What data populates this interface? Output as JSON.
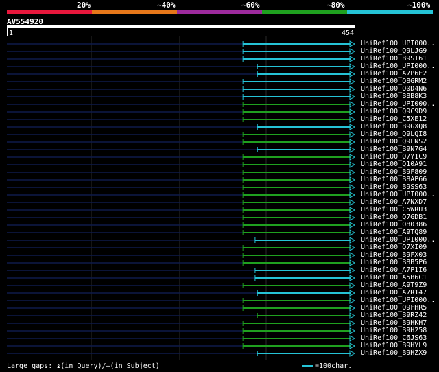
{
  "legend": {
    "labels": [
      "20%",
      "~40%",
      "~60%",
      "~80%",
      "~100%"
    ],
    "colors": [
      "#e8173c",
      "#e6771a",
      "#9c2a9c",
      "#1fa01f",
      "#25c3d6"
    ]
  },
  "query": {
    "title": "AV554920",
    "start": "1",
    "end": "454",
    "length": 454
  },
  "hits": [
    {
      "label": "UniRef100_UPI000..",
      "start": 310,
      "color": "cyan"
    },
    {
      "label": "UniRef100_Q9LJG9",
      "start": 310,
      "color": "cyan"
    },
    {
      "label": "UniRef100_B9ST61",
      "start": 310,
      "color": "cyan"
    },
    {
      "label": "UniRef100_UPI000..",
      "start": 329,
      "color": "cyan"
    },
    {
      "label": "UniRef100_A7P6E2",
      "start": 329,
      "color": "cyan"
    },
    {
      "label": "UniRef100_Q8GRM2",
      "start": 310,
      "color": "cyan"
    },
    {
      "label": "UniRef100_Q0D4N6",
      "start": 310,
      "color": "cyan"
    },
    {
      "label": "UniRef100_B8B8K3",
      "start": 310,
      "color": "cyan"
    },
    {
      "label": "UniRef100_UPI000..",
      "start": 310,
      "color": "green"
    },
    {
      "label": "UniRef100_Q9C9D9",
      "start": 310,
      "color": "green"
    },
    {
      "label": "UniRef100_C5XE12",
      "start": 310,
      "color": "green"
    },
    {
      "label": "UniRef100_B9GXQ8",
      "start": 329,
      "color": "cyan"
    },
    {
      "label": "UniRef100_Q9LQI8",
      "start": 310,
      "color": "green"
    },
    {
      "label": "UniRef100_Q9LNS2",
      "start": 310,
      "color": "green"
    },
    {
      "label": "UniRef100_B9N7G4",
      "start": 329,
      "color": "cyan"
    },
    {
      "label": "UniRef100_Q7Y1C9",
      "start": 310,
      "color": "green"
    },
    {
      "label": "UniRef100_Q10A91",
      "start": 310,
      "color": "green"
    },
    {
      "label": "UniRef100_B9F809",
      "start": 310,
      "color": "green"
    },
    {
      "label": "UniRef100_B8AP66",
      "start": 310,
      "color": "green"
    },
    {
      "label": "UniRef100_B9SS63",
      "start": 310,
      "color": "green"
    },
    {
      "label": "UniRef100_UPI000..",
      "start": 310,
      "color": "green"
    },
    {
      "label": "UniRef100_A7NXD7",
      "start": 310,
      "color": "green"
    },
    {
      "label": "UniRef100_C5WRU3",
      "start": 310,
      "color": "green"
    },
    {
      "label": "UniRef100_Q7GDB1",
      "start": 310,
      "color": "green"
    },
    {
      "label": "UniRef100_O80386",
      "start": 310,
      "color": "green"
    },
    {
      "label": "UniRef100_A9TQ89",
      "start": 310,
      "color": "green"
    },
    {
      "label": "UniRef100_UPI000..",
      "start": 326,
      "color": "cyan"
    },
    {
      "label": "UniRef100_Q7XI09",
      "start": 310,
      "color": "green"
    },
    {
      "label": "UniRef100_B9FX03",
      "start": 310,
      "color": "green"
    },
    {
      "label": "UniRef100_B8B5P6",
      "start": 310,
      "color": "green"
    },
    {
      "label": "UniRef100_A7P1I6",
      "start": 326,
      "color": "cyan"
    },
    {
      "label": "UniRef100_A5B6C1",
      "start": 326,
      "color": "cyan"
    },
    {
      "label": "UniRef100_A9T9Z9",
      "start": 310,
      "color": "green"
    },
    {
      "label": "UniRef100_A7R147",
      "start": 329,
      "color": "cyan"
    },
    {
      "label": "UniRef100_UPI000..",
      "start": 310,
      "color": "green"
    },
    {
      "label": "UniRef100_Q9FHR5",
      "start": 310,
      "color": "green"
    },
    {
      "label": "UniRef100_B9RZ42",
      "start": 329,
      "color": "green"
    },
    {
      "label": "UniRef100_B9HKH7",
      "start": 310,
      "color": "green"
    },
    {
      "label": "UniRef100_B9H258",
      "start": 310,
      "color": "green"
    },
    {
      "label": "UniRef100_C6JS63",
      "start": 310,
      "color": "green"
    },
    {
      "label": "UniRef100_B9HYL9",
      "start": 310,
      "color": "green"
    },
    {
      "label": "UniRef100_B9HZX9",
      "start": 329,
      "color": "cyan"
    }
  ],
  "footer": {
    "large_gaps": "Large gaps: ",
    "query_gap": "(in Query)/",
    "subject_gap": "(in Subject)",
    "scale": "=100char."
  }
}
